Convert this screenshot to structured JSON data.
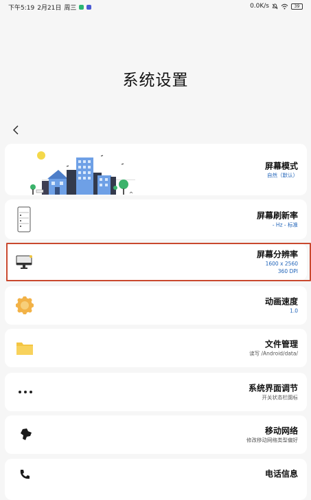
{
  "status_bar": {
    "time": "下午5:19",
    "date": "2月21日",
    "weekday": "周三",
    "net_speed": "0.0K/s",
    "battery": "39"
  },
  "header": {
    "title": "系统设置"
  },
  "settings": [
    {
      "title": "屏幕模式",
      "subtitle": "自然（默认）",
      "icon": "city-illustration"
    },
    {
      "title": "屏幕刷新率",
      "subtitle": "- Hz - 标准",
      "icon": "phone-list-icon"
    },
    {
      "title": "屏幕分辨率",
      "subtitle": "1600 x 2560",
      "subtitle2": "360 DPI",
      "icon": "monitor-icon"
    },
    {
      "title": "动画速度",
      "subtitle": "1.0",
      "icon": "gear-icon"
    },
    {
      "title": "文件管理",
      "subtitle": "读写 /Android/data/",
      "icon": "folder-icon"
    },
    {
      "title": "系统界面调节",
      "subtitle": "开关状态栏图标",
      "icon": "dots-icon"
    },
    {
      "title": "移动网络",
      "subtitle": "修改移动网络类型偏好",
      "icon": "map-icon"
    },
    {
      "title": "电话信息",
      "icon": "phone-icon"
    }
  ],
  "colors": {
    "accent": "#1e62b8",
    "highlight": "#c9482e",
    "card": "#ffffff",
    "background": "#f6f6f6"
  }
}
